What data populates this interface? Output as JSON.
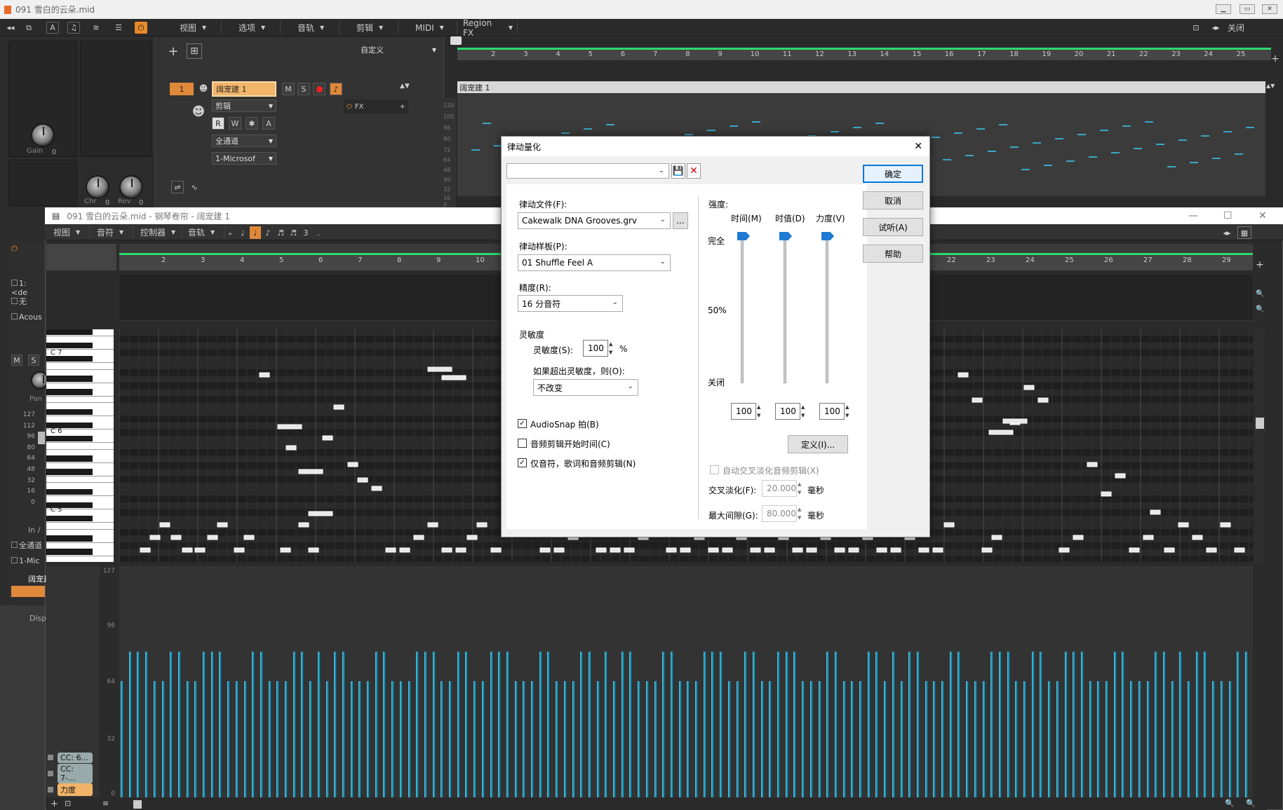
{
  "main_window": {
    "title": "091 雪白的云朵.mid",
    "min_label": "▭",
    "max_label": "▭",
    "close_label": "✕"
  },
  "top_toolbar": {
    "menus": [
      {
        "label": "视图"
      },
      {
        "label": "选项"
      },
      {
        "label": "音轨"
      },
      {
        "label": "剪辑"
      },
      {
        "label": "MIDI"
      },
      {
        "label": "Region FX"
      }
    ],
    "close_label": "关闭",
    "preset_label": "自定义"
  },
  "inspector": {
    "gain_label": "Gain",
    "gain_value": "0",
    "chr_label": "Chr",
    "chr_value": "0",
    "rev_label": "Rev",
    "rev_value": "0"
  },
  "track": {
    "number": "1",
    "name": "阔宠建 1",
    "mute": "M",
    "solo": "S",
    "clip_mode": "剪辑",
    "r": "R",
    "w": "W",
    "star": "✱",
    "a": "A",
    "channel": "全通道",
    "output": "1-Microsof",
    "fx_label": "FX"
  },
  "top_ruler": {
    "ticks": [
      "2",
      "3",
      "4",
      "5",
      "6",
      "7",
      "8",
      "9",
      "10",
      "11",
      "12",
      "13",
      "14",
      "15",
      "16",
      "17",
      "18",
      "19",
      "20",
      "21",
      "22",
      "23",
      "24",
      "25"
    ]
  },
  "clip_header": {
    "name": "阔宠建 1"
  },
  "clip_vel_ticks": [
    "120",
    "100",
    "96",
    "80",
    "72",
    "64",
    "48",
    "40",
    "32",
    "16",
    "0"
  ],
  "piano_roll": {
    "title": "091 雪白的云朵.mid - 钢琴卷帘 - 阔宠建 1",
    "menus": [
      {
        "label": "视图"
      },
      {
        "label": "音符"
      },
      {
        "label": "控制器"
      },
      {
        "label": "音轨"
      }
    ],
    "ruler_ticks_left": [
      "2",
      "3",
      "4",
      "5",
      "6",
      "7",
      "8",
      "9",
      "10"
    ],
    "ruler_ticks_right": [
      "22",
      "23",
      "24",
      "25",
      "26",
      "27",
      "28",
      "29"
    ],
    "octave_labels": [
      "C 7",
      "C 6",
      "C 5"
    ],
    "side_track_items": [
      "1: <de",
      "无",
      "Acous"
    ],
    "side_labels": {
      "pan": "Pan",
      "in": "In /",
      "channel": "全通道",
      "output": "1-Mic",
      "track": "阔宠建",
      "disp": "Disp",
      "m": "M",
      "s": "S"
    },
    "side_vel_ticks": [
      "127",
      "112",
      "96",
      "80",
      "64",
      "48",
      "32",
      "16",
      "0"
    ],
    "vel_axis": [
      "127",
      "96",
      "64",
      "32",
      "0"
    ],
    "lanes": [
      {
        "label": "CC: 6..."
      },
      {
        "label": "CC: 7-..."
      },
      {
        "label": "力度"
      }
    ]
  },
  "dialog": {
    "title": "律动量化",
    "groove_file_label": "律动文件(F):",
    "groove_file_value": "Cakewalk DNA Grooves.grv",
    "browse_label": "...",
    "groove_pattern_label": "律动样板(P):",
    "groove_pattern_value": "01 Shuffle Feel A",
    "resolution_label": "精度(R):",
    "resolution_value": "16 分音符",
    "sensitivity_group": "灵敏度",
    "sensitivity_label": "灵敏度(S):",
    "sensitivity_value": "100",
    "sensitivity_unit": "%",
    "outside_label": "如果超出灵敏度，则(O):",
    "outside_value": "不改变",
    "audiosnap_label": "AudioSnap 拍(B)",
    "audiosnap_checked": true,
    "audio_start_label": "音频剪辑开始时间(C)",
    "audio_start_checked": false,
    "notes_only_label": "仅音符，歌词和音频剪辑(N)",
    "notes_only_checked": true,
    "strength_label": "强度:",
    "col_time": "时间(M)",
    "col_duration": "时值(D)",
    "col_velocity": "力度(V)",
    "level_full": "完全",
    "level_half": "50%",
    "level_off": "关闭",
    "time_value": "100",
    "duration_value": "100",
    "velocity_value": "100",
    "define_label": "定义(I)...",
    "crossfade_check_label": "自动交叉淡化音频剪辑(X)",
    "crossfade_label": "交叉淡化(F):",
    "crossfade_value": "20.000",
    "crossfade_unit": "毫秒",
    "max_gap_label": "最大间隙(G):",
    "max_gap_value": "80.000",
    "max_gap_unit": "毫秒",
    "ok_label": "确定",
    "cancel_label": "取消",
    "audition_label": "试听(A)",
    "help_label": "帮助",
    "close_icon": "✕"
  }
}
